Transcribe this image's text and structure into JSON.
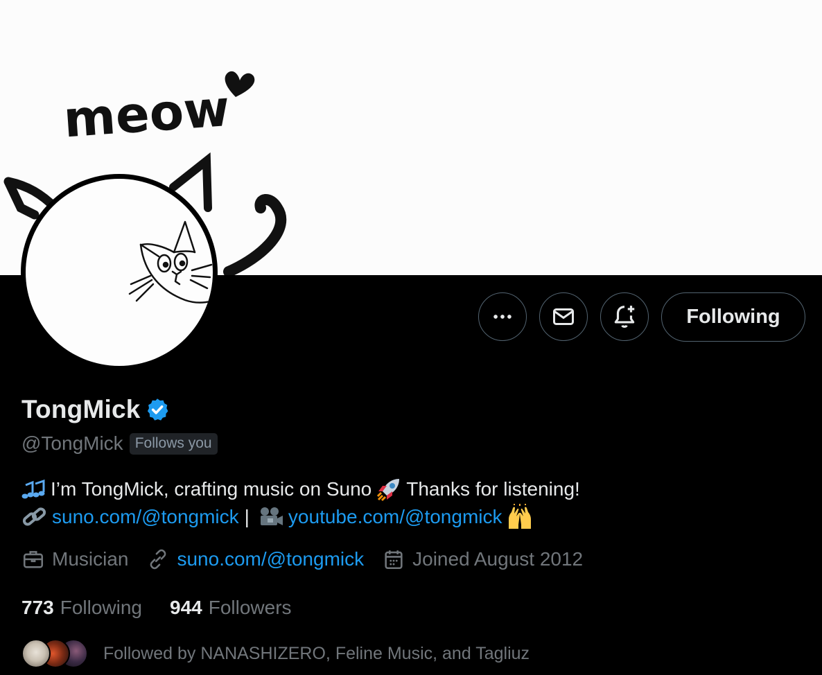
{
  "profile": {
    "display_name": "TongMick",
    "handle": "@TongMick",
    "follows_you": "Follows you",
    "verified": true
  },
  "banner": {
    "text": "meow"
  },
  "actions": {
    "following_label": "Following"
  },
  "bio": {
    "line1_text": "I’m TongMick, crafting music on Suno",
    "line1_suffix": "Thanks for listening!",
    "line2_link1": "suno.com/@tongmick",
    "line2_separator": "|",
    "line2_link2": "youtube.com/@tongmick"
  },
  "meta": {
    "category": "Musician",
    "website": "suno.com/@tongmick",
    "joined": "Joined August 2012"
  },
  "stats": {
    "following_count": "773",
    "following_label": "Following",
    "followers_count": "944",
    "followers_label": "Followers"
  },
  "followed_by": {
    "text": "Followed by NANASHIZERO, Feline Music, and Tagliuz"
  },
  "colors": {
    "background": "#000000",
    "text": "#e7e9ea",
    "secondary_text": "#71767b",
    "link": "#1d9bf0",
    "border": "#536471"
  },
  "icons": [
    "more-icon",
    "mail-icon",
    "notification-add-icon",
    "verified-badge-icon",
    "briefcase-icon",
    "link-icon",
    "calendar-icon"
  ]
}
